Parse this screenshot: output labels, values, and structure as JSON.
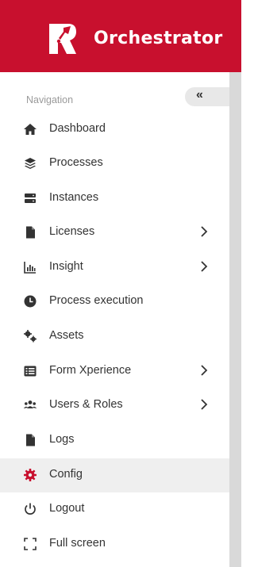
{
  "app": {
    "title": "Orchestrator",
    "brand_color": "#c8102e"
  },
  "sidebar": {
    "section_label": "Navigation",
    "collapse_label": "«",
    "items": [
      {
        "label": "Dashboard",
        "icon": "home-icon",
        "has_submenu": false,
        "active": false
      },
      {
        "label": "Processes",
        "icon": "layers-icon",
        "has_submenu": false,
        "active": false
      },
      {
        "label": "Instances",
        "icon": "server-icon",
        "has_submenu": false,
        "active": false
      },
      {
        "label": "Licenses",
        "icon": "file-icon",
        "has_submenu": true,
        "active": false
      },
      {
        "label": "Insight",
        "icon": "bar-chart-icon",
        "has_submenu": true,
        "active": false
      },
      {
        "label": "Process execution",
        "icon": "clock-icon",
        "has_submenu": false,
        "active": false
      },
      {
        "label": "Assets",
        "icon": "gears-icon",
        "has_submenu": false,
        "active": false
      },
      {
        "label": "Form Xperience",
        "icon": "list-form-icon",
        "has_submenu": true,
        "active": false
      },
      {
        "label": "Users & Roles",
        "icon": "users-icon",
        "has_submenu": true,
        "active": false
      },
      {
        "label": "Logs",
        "icon": "file-icon",
        "has_submenu": false,
        "active": false
      },
      {
        "label": "Config",
        "icon": "gear-icon",
        "has_submenu": false,
        "active": true
      },
      {
        "label": "Logout",
        "icon": "power-icon",
        "has_submenu": false,
        "active": false
      },
      {
        "label": "Full screen",
        "icon": "expand-icon",
        "has_submenu": false,
        "active": false
      }
    ]
  }
}
